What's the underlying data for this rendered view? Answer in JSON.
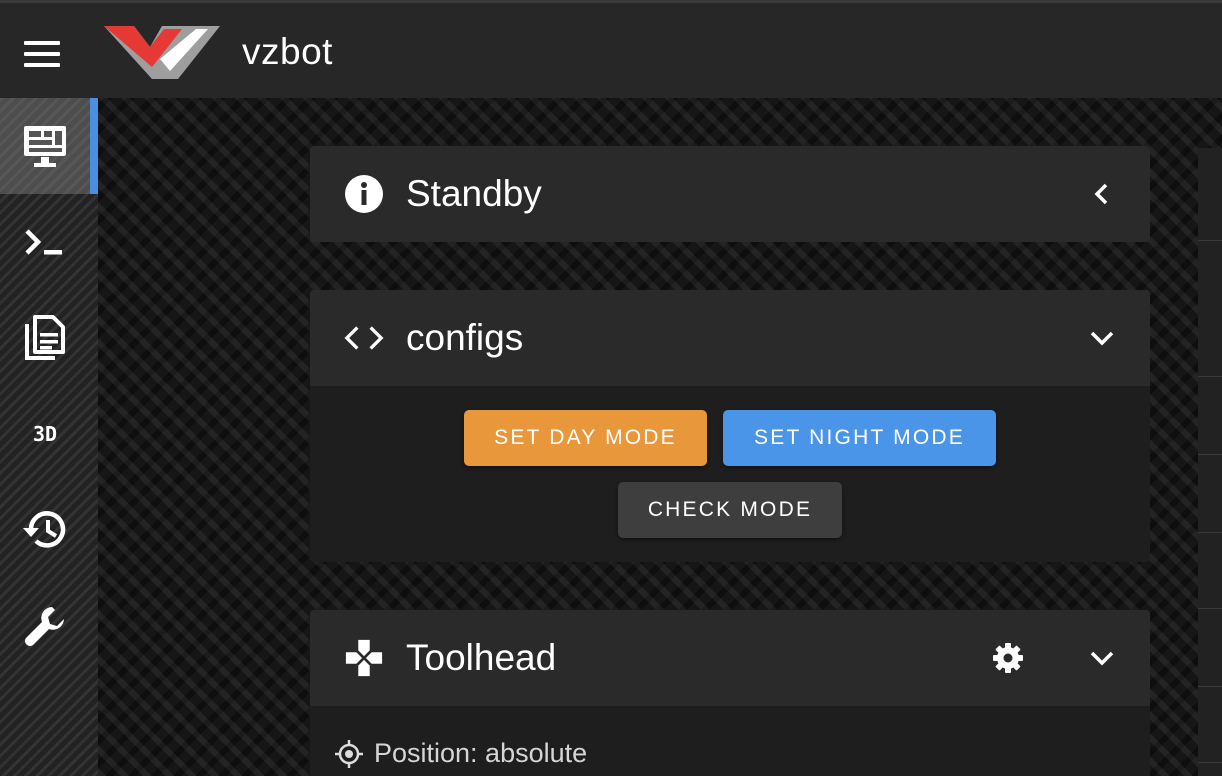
{
  "app": {
    "title": "vzbot"
  },
  "nav": {
    "items": [
      {
        "name": "dashboard",
        "icon": "monitor-dashboard-icon",
        "active": true
      },
      {
        "name": "console",
        "icon": "console-icon",
        "active": false
      },
      {
        "name": "files",
        "icon": "file-document-icon",
        "active": false
      },
      {
        "name": "3d-viewer",
        "label": "3D",
        "active": false
      },
      {
        "name": "history",
        "icon": "history-icon",
        "active": false
      },
      {
        "name": "machine",
        "icon": "wrench-icon",
        "active": false
      }
    ]
  },
  "panels": {
    "standby": {
      "title": "Standby",
      "icon": "info-icon",
      "toggle_icon": "chevron-left-icon"
    },
    "configs": {
      "title": "configs",
      "icon": "code-icon",
      "toggle_icon": "chevron-down-icon",
      "buttons": {
        "day": "SET DAY MODE",
        "night": "SET NIGHT MODE",
        "check": "CHECK MODE"
      }
    },
    "toolhead": {
      "title": "Toolhead",
      "icon": "gamepad-icon",
      "settings_icon": "gear-icon",
      "toggle_icon": "chevron-down-icon",
      "position_label": "Position: absolute"
    }
  },
  "colors": {
    "day_button": "#e8973a",
    "night_button": "#4a95e8",
    "check_button": "#3e3e3e",
    "active_indicator": "#4a90e2",
    "logo_red": "#e53935",
    "logo_grey": "#9e9e9e"
  }
}
